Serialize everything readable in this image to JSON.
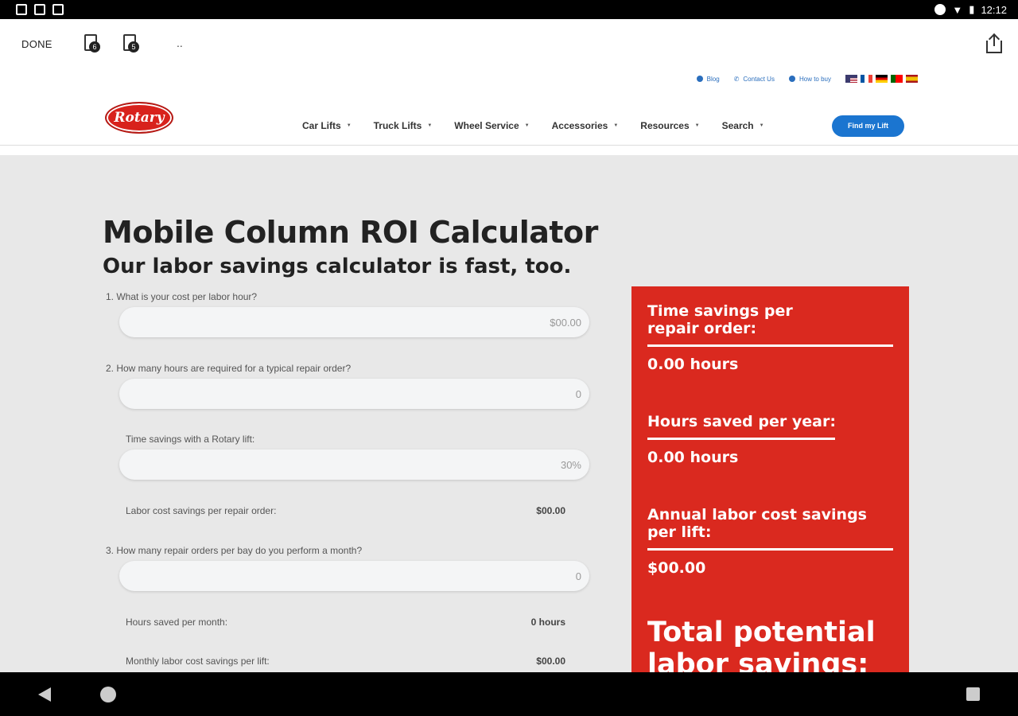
{
  "statusbar": {
    "time": "12:12"
  },
  "toolbar": {
    "done_label": "DONE",
    "more": "..",
    "icon1_badge": "6",
    "icon2_badge": "5"
  },
  "utility": {
    "blog": "Blog",
    "contact": "Contact Us",
    "how_to_buy": "How to buy"
  },
  "logo": {
    "text": "Rotary",
    "color": "#d8221c"
  },
  "nav": {
    "items": [
      "Car Lifts",
      "Truck Lifts",
      "Wheel Service",
      "Accessories",
      "Resources",
      "Search"
    ],
    "cta": "Find my Lift",
    "cta_color": "#1b75d0"
  },
  "page": {
    "title": "Mobile Column ROI Calculator",
    "subtitle": "Our labor savings calculator is fast, too."
  },
  "form": {
    "q1": "1. What is your cost per labor hour?",
    "q1_placeholder": "$00.00",
    "q2": "2. How many hours are required for a typical repair order?",
    "q2_placeholder": "0",
    "time_savings_label": "Time savings with a Rotary lift:",
    "time_savings_placeholder": "30%",
    "labor_cost_label": "Labor cost savings per repair order:",
    "labor_cost_value": "$00.00",
    "q3": "3. How many repair orders per bay do you perform a month?",
    "q3_placeholder": "0",
    "hours_month_label": "Hours saved per month:",
    "hours_month_value": "0 hours",
    "monthly_cost_label": "Monthly labor cost savings per lift:",
    "monthly_cost_value": "$00.00"
  },
  "results": {
    "accent": "#da291f",
    "time_per_order_label": "Time savings per repair order:",
    "time_per_order_value": "0.00 hours",
    "hours_year_label": "Hours saved per year:",
    "hours_year_value": "0.00 hours",
    "annual_cost_label": "Annual labor cost savings per lift:",
    "annual_cost_value": "$00.00",
    "total_label": "Total potential labor savings:"
  }
}
